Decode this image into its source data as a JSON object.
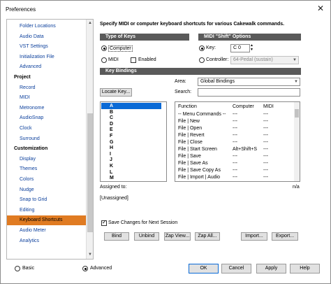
{
  "window": {
    "title": "Preferences"
  },
  "sidebar": {
    "items": [
      {
        "label": "Folder Locations",
        "kind": "child"
      },
      {
        "label": "Audio Data",
        "kind": "child"
      },
      {
        "label": "VST Settings",
        "kind": "child"
      },
      {
        "label": "Initialization File",
        "kind": "child"
      },
      {
        "label": "Advanced",
        "kind": "child"
      },
      {
        "label": "Project",
        "kind": "cat"
      },
      {
        "label": "Record",
        "kind": "child"
      },
      {
        "label": "MIDI",
        "kind": "child"
      },
      {
        "label": "Metronome",
        "kind": "child"
      },
      {
        "label": "AudioSnap",
        "kind": "child"
      },
      {
        "label": "Clock",
        "kind": "child"
      },
      {
        "label": "Surround",
        "kind": "child"
      },
      {
        "label": "Customization",
        "kind": "cat"
      },
      {
        "label": "Display",
        "kind": "child"
      },
      {
        "label": "Themes",
        "kind": "child"
      },
      {
        "label": "Colors",
        "kind": "child"
      },
      {
        "label": "Nudge",
        "kind": "child"
      },
      {
        "label": "Snap to Grid",
        "kind": "child"
      },
      {
        "label": "Editing",
        "kind": "child"
      },
      {
        "label": "Keyboard Shortcuts",
        "kind": "child",
        "selected": true
      },
      {
        "label": "Audio Meter",
        "kind": "child"
      },
      {
        "label": "Analytics",
        "kind": "child"
      }
    ]
  },
  "main": {
    "intro": "Specify MIDI or computer keyboard shortcuts for various Cakewalk commands.",
    "type_of_keys": {
      "header": "Type of Keys",
      "computer": "Computer",
      "midi": "MIDI",
      "enabled": "Enabled"
    },
    "midi_shift": {
      "header": "MIDI \"Shift\" Options",
      "key_label": "Key:",
      "key_value": "C 0",
      "controller_label": "Controller:",
      "controller_value": "64-Pedal (sustain)"
    },
    "key_bindings": {
      "header": "Key Bindings",
      "area_label": "Area:",
      "area_value": "Global Bindings",
      "search_label": "Search:",
      "search_value": "",
      "locate_key": "Locate Key...",
      "keys": [
        "A",
        "B",
        "C",
        "D",
        "E",
        "F",
        "G",
        "H",
        "I",
        "J",
        "K",
        "L",
        "M"
      ],
      "columns": [
        "Function",
        "Computer",
        "MIDI"
      ],
      "rows": [
        [
          "-- Menu Commands --",
          "---",
          "---"
        ],
        [
          "File | New",
          "---",
          "---"
        ],
        [
          "File | Open",
          "---",
          "---"
        ],
        [
          "File | Revert",
          "---",
          "---"
        ],
        [
          "File | Close",
          "---",
          "---"
        ],
        [
          "File | Start Screen",
          "Alt+Shift+S",
          "---"
        ],
        [
          "File | Save",
          "---",
          "---"
        ],
        [
          "File | Save As",
          "---",
          "---"
        ],
        [
          "File | Save Copy As",
          "---",
          "---"
        ],
        [
          "File | Import | Audio",
          "---",
          "---"
        ]
      ],
      "assigned_to": "Assigned to:",
      "na": "n/a",
      "assigned_value": "[Unassigned]"
    },
    "save_changes": "Save Changes for Next Session",
    "buttons": {
      "bind": "Bind",
      "unbind": "Unbind",
      "zap_view": "Zap View...",
      "zap_all": "Zap All...",
      "import": "Import...",
      "export": "Export..."
    }
  },
  "footer": {
    "basic": "Basic",
    "advanced": "Advanced",
    "ok": "OK",
    "cancel": "Cancel",
    "apply": "Apply",
    "help": "Help"
  }
}
